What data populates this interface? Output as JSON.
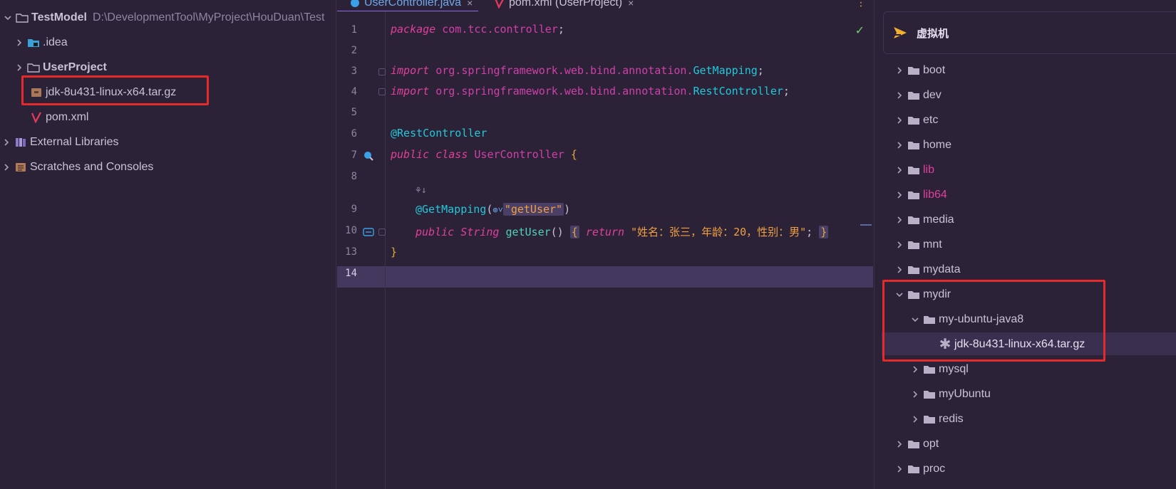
{
  "project": {
    "root": {
      "name": "TestModel",
      "path": "D:\\DevelopmentTool\\MyProject\\HouDuan\\Test"
    },
    "items": [
      {
        "label": ".idea"
      },
      {
        "label": "UserProject"
      },
      {
        "label": "jdk-8u431-linux-x64.tar.gz"
      },
      {
        "label": "pom.xml"
      },
      {
        "label": "External Libraries"
      },
      {
        "label": "Scratches and Consoles"
      }
    ]
  },
  "editor": {
    "tabs": [
      {
        "label": "UserController.java",
        "close": "×"
      },
      {
        "label": "pom.xml (UserProject)",
        "close": "×"
      }
    ],
    "line_numbers": [
      "1",
      "2",
      "3",
      "4",
      "5",
      "6",
      "7",
      "8",
      "9",
      "10",
      "13",
      "14"
    ],
    "code": {
      "l1_kw": "package",
      "l1_pkg": "com.tcc.controller",
      "l1_end": ";",
      "l3_kw": "import",
      "l3_pkg": "org.springframework.web.bind.annotation.",
      "l3_cls": "GetMapping",
      "l3_end": ";",
      "l4_kw": "import",
      "l4_pkg": "org.springframework.web.bind.annotation.",
      "l4_cls": "RestController",
      "l4_end": ";",
      "l6_ann": "@RestController",
      "l7_kw1": "public",
      "l7_kw2": "class",
      "l7_cls": "UserController",
      "l7_brace": "{",
      "l9_ann": "@GetMapping",
      "l9_open": "(",
      "l9_str": "\"getUser\"",
      "l9_close": ")",
      "l10_kw": "public",
      "l10_type": "String",
      "l10_fn": "getUser",
      "l10_paren": "()",
      "l10_brace_open": "{",
      "l10_ret": "return",
      "l10_str": "\"姓名：张三，年龄：20，性别：男\"",
      "l10_semi": ";",
      "l10_brace_close": "}",
      "l13_brace": "}"
    }
  },
  "remote": {
    "title": "虚拟机",
    "items": [
      {
        "label": "boot"
      },
      {
        "label": "dev"
      },
      {
        "label": "etc"
      },
      {
        "label": "home"
      },
      {
        "label": "lib"
      },
      {
        "label": "lib64"
      },
      {
        "label": "media"
      },
      {
        "label": "mnt"
      },
      {
        "label": "mydata"
      },
      {
        "label": "mydir"
      },
      {
        "label": "my-ubuntu-java8"
      },
      {
        "label": "jdk-8u431-linux-x64.tar.gz"
      },
      {
        "label": "mysql"
      },
      {
        "label": "myUbuntu"
      },
      {
        "label": "redis"
      },
      {
        "label": "opt"
      },
      {
        "label": "proc"
      }
    ]
  },
  "colors": {
    "background": "#2b2238",
    "highlight_box": "#e42a2a",
    "keyword": "#e0409a",
    "type": "#22c8d8",
    "string": "#f0a040"
  }
}
